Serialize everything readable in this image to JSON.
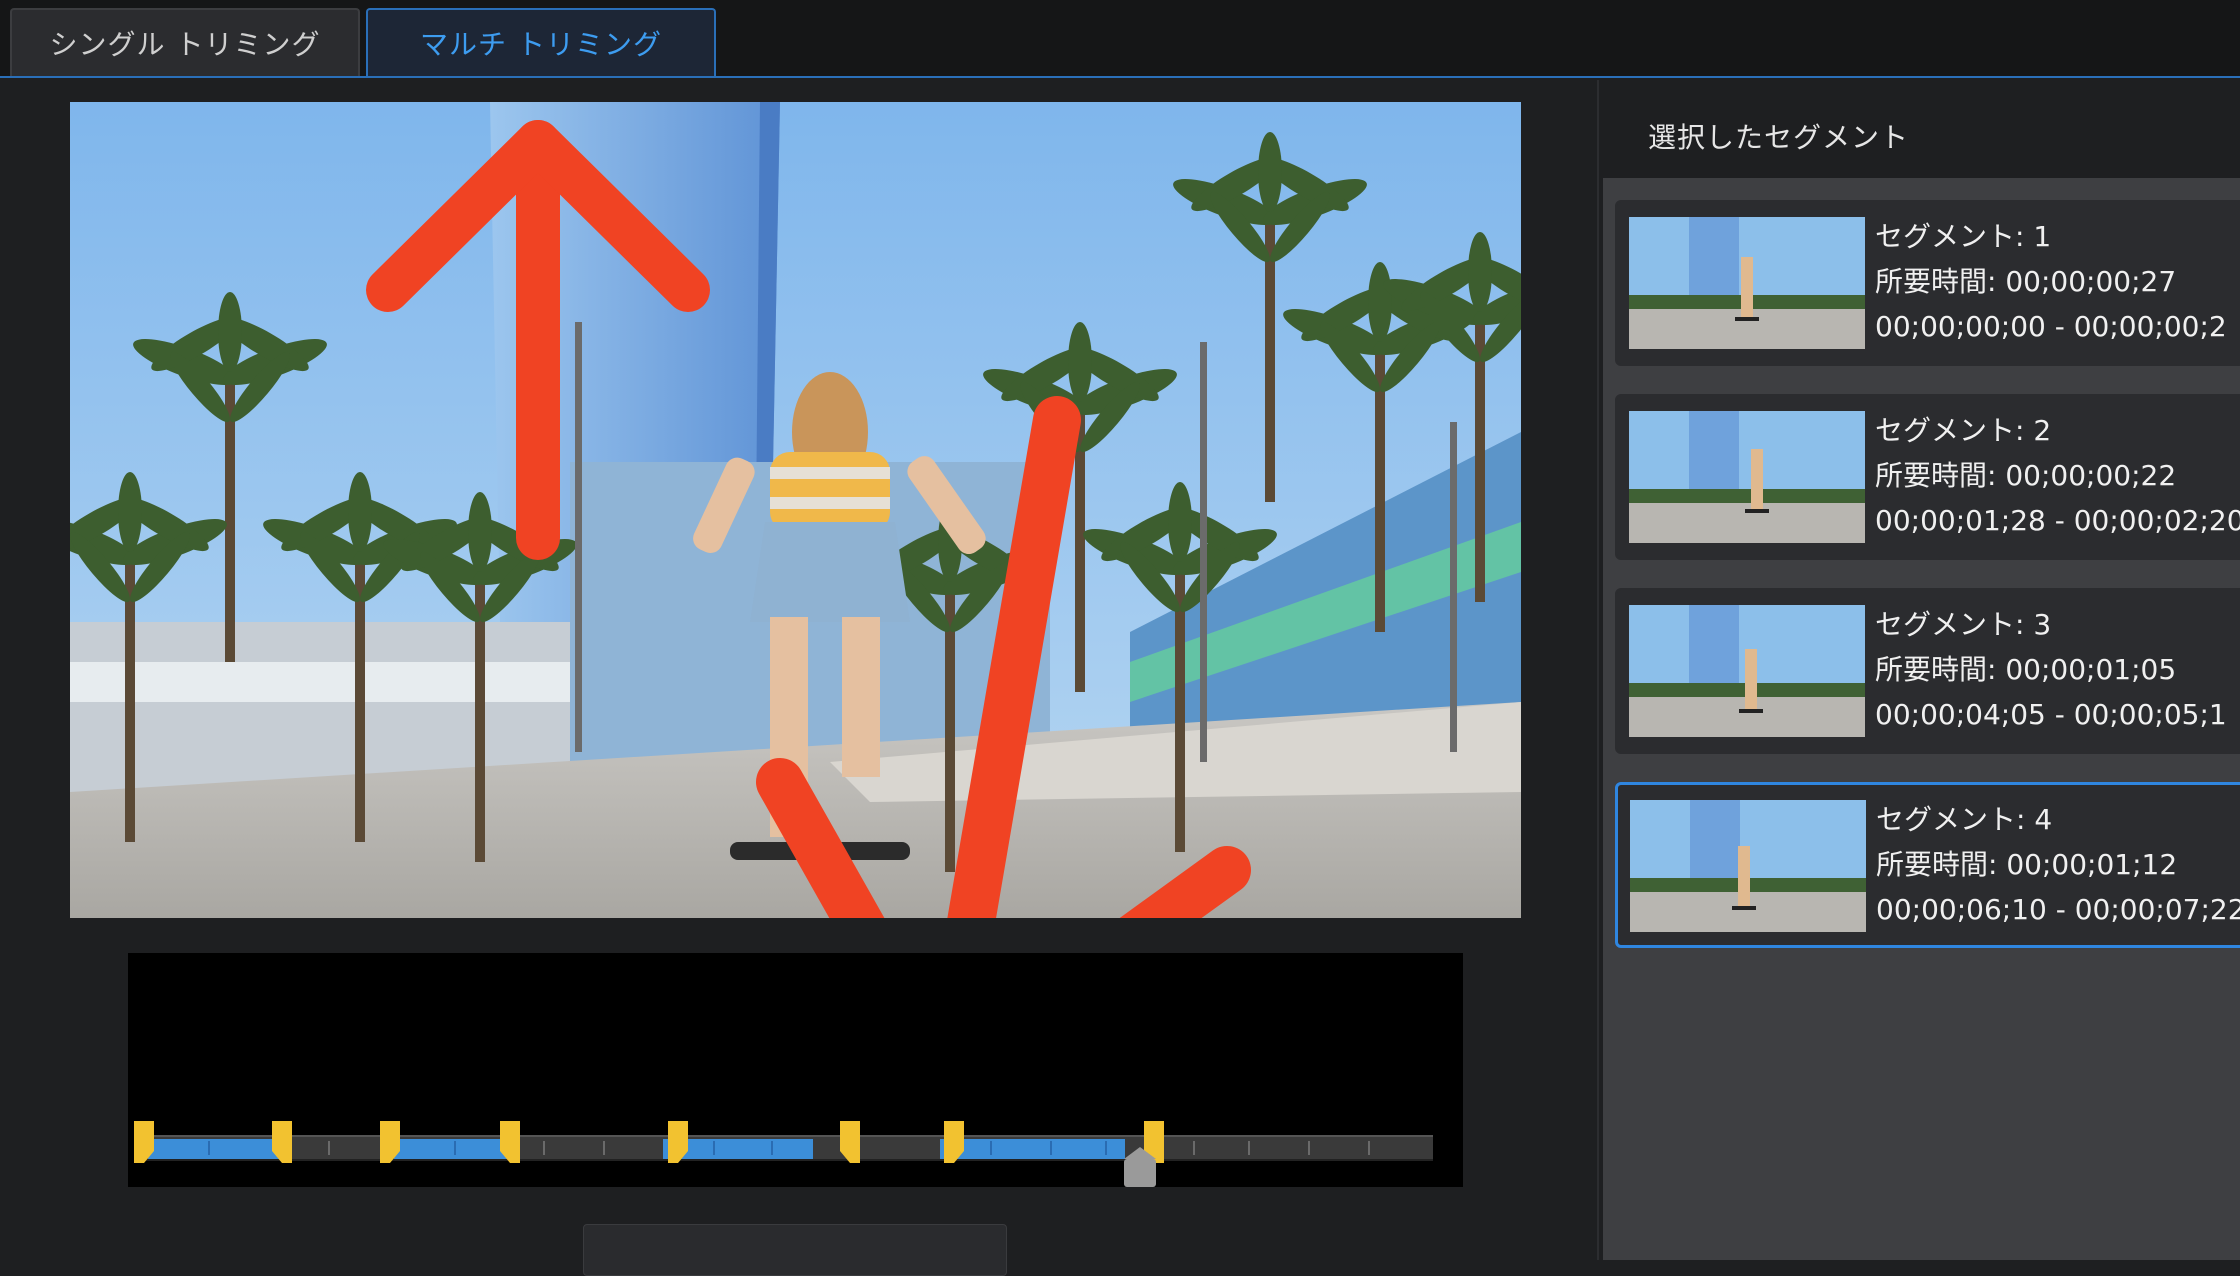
{
  "tabs": {
    "single": "シングル トリミング",
    "multi": "マルチ トリミング",
    "active": "multi"
  },
  "panel": {
    "title": "選択したセグメント"
  },
  "segments": [
    {
      "name": "セグメント: 1",
      "duration": "所要時間: 00;00;00;27",
      "range": "00;00;00;00 - 00;00;00;2"
    },
    {
      "name": "セグメント: 2",
      "duration": "所要時間: 00;00;00;22",
      "range": "00;00;01;28 - 00;00;02;20"
    },
    {
      "name": "セグメント: 3",
      "duration": "所要時間: 00;00;01;05",
      "range": "00;00;04;05 - 00;00;05;1"
    },
    {
      "name": "セグメント: 4",
      "duration": "所要時間: 00;00;01;12",
      "range": "00;00;06;10 - 00;00;07;22"
    }
  ],
  "selected_segment": 4,
  "colors": {
    "accent": "#2f86e0",
    "segment_fill": "#3c8ed8",
    "marker": "#f2c230",
    "annotation_arrow": "#f04323"
  },
  "icons": {
    "segment_marker": "marker-icon",
    "playhead": "playhead-icon",
    "annotation_up": "arrow-up-icon",
    "annotation_down": "arrow-down-icon"
  }
}
